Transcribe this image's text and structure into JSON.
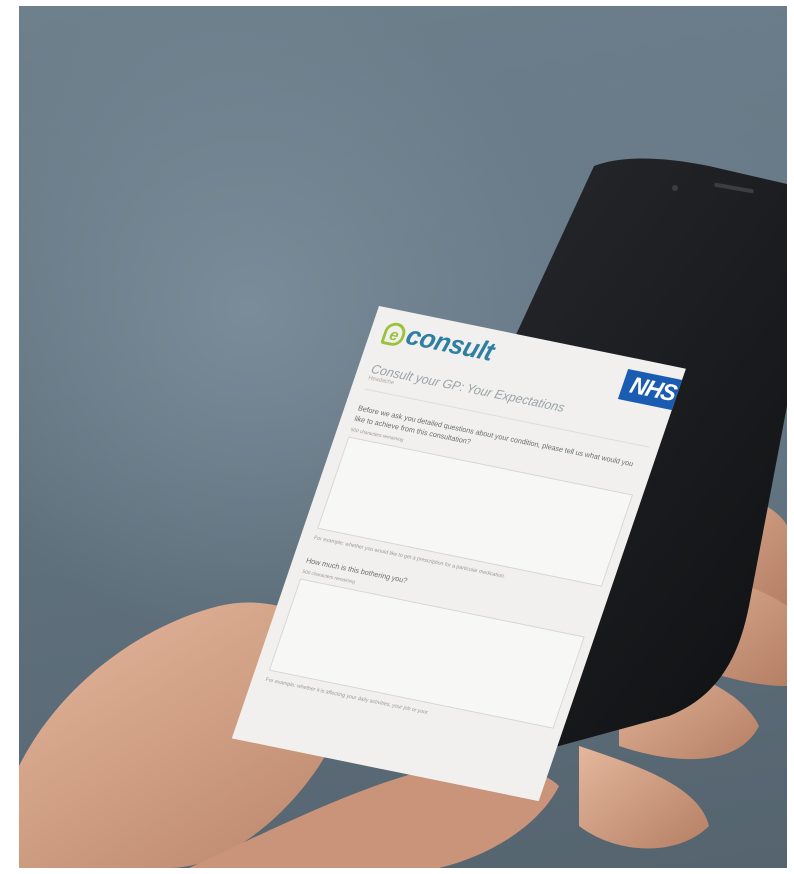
{
  "screen": {
    "brand": {
      "logo_text": "consult",
      "logo_mark": "e",
      "partner_badge": "NHS"
    },
    "title": "Consult your GP: Your Expectations",
    "subtitle": "Headache",
    "question_1": "Before we ask you detailed questions about your condition, please tell us what would you like to achieve from this consultation?",
    "hint_1": "500 characters remaining",
    "note_1": "For example: whether you would like to get a prescription for a particular medication.",
    "question_2": "How much is this bothering you?",
    "hint_2": "500 characters remaining",
    "note_2": "For example: whether it is affecting your daily activities, your job or your"
  },
  "colors": {
    "background": "#667885",
    "logo_blue": "#2e7fa1",
    "logo_green": "#9bc23a",
    "nhs_blue": "#1b5cb3",
    "phone": "#1c1d20",
    "skin": "#d8a88c"
  }
}
